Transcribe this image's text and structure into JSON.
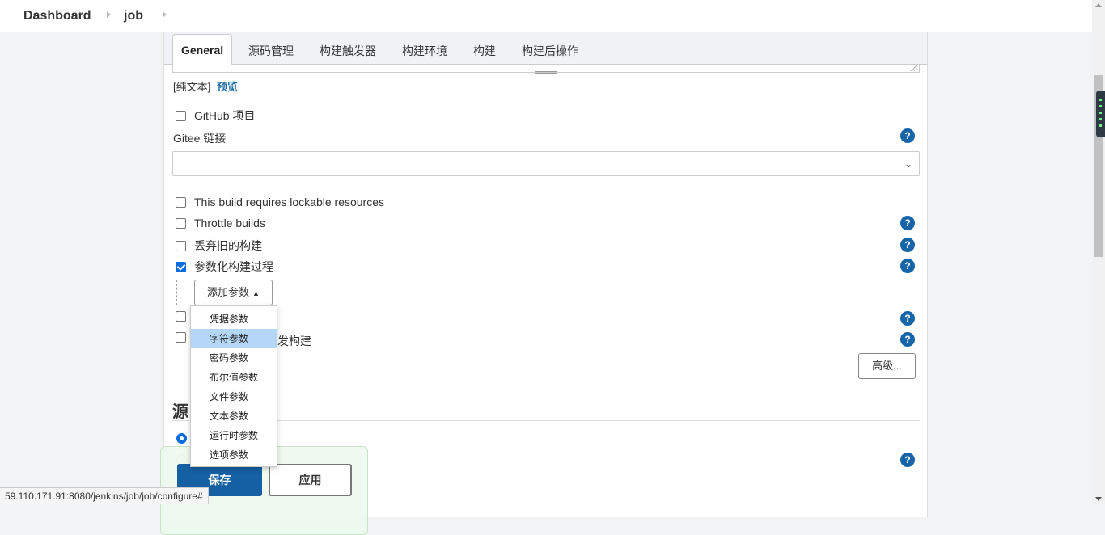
{
  "breadcrumb": {
    "dashboard": "Dashboard",
    "job": "job"
  },
  "tabs": [
    {
      "label": "General"
    },
    {
      "label": "源码管理"
    },
    {
      "label": "构建触发器"
    },
    {
      "label": "构建环境"
    },
    {
      "label": "构建"
    },
    {
      "label": "构建后操作"
    }
  ],
  "description": {
    "plain_text": "[纯文本]",
    "preview": "预览"
  },
  "options": {
    "github_project": "GitHub 项目",
    "gitee_link_label": "Gitee 链接",
    "gitee_link_value": "",
    "lockable": "This build requires lockable resources",
    "throttle": "Throttle builds",
    "discard_old": "丢弃旧的构建",
    "parameterized": "参数化构建过程",
    "concurrent_partial": "发构建"
  },
  "add_param": {
    "label": "添加参数"
  },
  "param_menu": [
    "凭据参数",
    "字符参数",
    "密码参数",
    "布尔值参数",
    "文件参数",
    "文本参数",
    "运行时参数",
    "选项参数"
  ],
  "advanced_label": "高级...",
  "section": {
    "heading": "源"
  },
  "actions": {
    "save": "保存",
    "apply": "应用"
  },
  "help_glyph": "?",
  "status_url": "59.110.171.91:8080/jenkins/job/job/configure#",
  "colors": {
    "accent": "#1560a2",
    "checkbox": "#0b6ce0",
    "help": "#1565a8",
    "menu_hover": "#b4d7f7"
  }
}
